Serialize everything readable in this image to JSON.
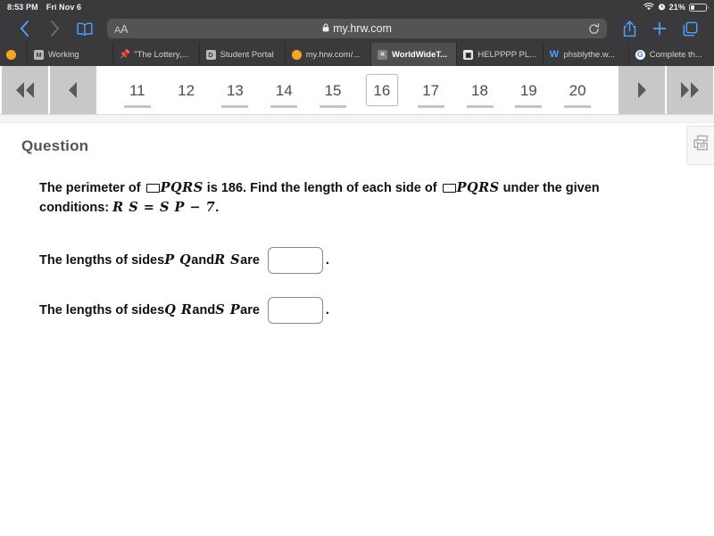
{
  "status_bar": {
    "time": "8:53 PM",
    "date": "Fri Nov 6",
    "wifi_icon": "wifi-icon",
    "alarm_icon": "alarm-clock-icon",
    "battery_percent": "21%",
    "battery_level": 21
  },
  "toolbar": {
    "back_icon": "chevron-left-icon",
    "forward_icon": "chevron-right-icon",
    "bookmarks_icon": "book-icon",
    "text_size_label": "AA",
    "lock_icon": "lock-icon",
    "url": "my.hrw.com",
    "reload_icon": "reload-icon",
    "share_icon": "share-icon",
    "new_tab_icon": "plus-icon",
    "tabs_overview_icon": "tabs-icon"
  },
  "tabs": [
    {
      "label": "",
      "favicon": "dot-orange",
      "active": false
    },
    {
      "label": "Working",
      "favicon": "letter-m",
      "active": false
    },
    {
      "label": "\"The Lottery,...",
      "favicon": "pushpin",
      "active": false
    },
    {
      "label": "Student Portal",
      "favicon": "letter-d",
      "active": false
    },
    {
      "label": "my.hrw.com/...",
      "favicon": "dot-orange",
      "active": false
    },
    {
      "label": "WorldWideT...",
      "favicon": "box-x",
      "active": true
    },
    {
      "label": "HELPPPP PL...",
      "favicon": "dark-square",
      "active": false
    },
    {
      "label": "phsblythe.w...",
      "favicon": "letter-w",
      "active": false
    },
    {
      "label": "Complete th...",
      "favicon": "google-g",
      "active": false
    }
  ],
  "pagination": {
    "first_icon": "double-chevron-left-icon",
    "prev_icon": "chevron-left-icon",
    "next_icon": "chevron-right-icon",
    "last_icon": "double-chevron-right-icon",
    "pages": [
      {
        "number": "11",
        "current": false,
        "underlined": true
      },
      {
        "number": "12",
        "current": false,
        "underlined": false
      },
      {
        "number": "13",
        "current": false,
        "underlined": true
      },
      {
        "number": "14",
        "current": false,
        "underlined": true
      },
      {
        "number": "15",
        "current": false,
        "underlined": true
      },
      {
        "number": "16",
        "current": true,
        "underlined": false
      },
      {
        "number": "17",
        "current": false,
        "underlined": true
      },
      {
        "number": "18",
        "current": false,
        "underlined": true
      },
      {
        "number": "19",
        "current": false,
        "underlined": true
      },
      {
        "number": "20",
        "current": false,
        "underlined": true
      }
    ]
  },
  "question": {
    "heading": "Question",
    "prompt": {
      "part1": "The perimeter of ",
      "shape1": "PQRS",
      "part2": " is 186. Find the length of each side of ",
      "shape2": "PQRS",
      "part3": " under the given conditions: ",
      "condition": "R S = S P − 7",
      "part4": "."
    },
    "answers": [
      {
        "lead": "The lengths of sides ",
        "var1": "P Q",
        "mid": " and ",
        "var2": "R S",
        "tail": " are",
        "value": "",
        "placeholder": "",
        "period": "."
      },
      {
        "lead": "The lengths of sides ",
        "var1": "Q R",
        "mid": " and ",
        "var2": "S P",
        "tail": " are",
        "value": "",
        "placeholder": "",
        "period": "."
      }
    ]
  },
  "sidebar": {
    "print_icon": "printer-icon"
  },
  "colors": {
    "chrome": "#3a3a3c",
    "accent": "#4da2ff",
    "nav_button": "#c8c8c8",
    "page_text": "#4c4c4c"
  }
}
